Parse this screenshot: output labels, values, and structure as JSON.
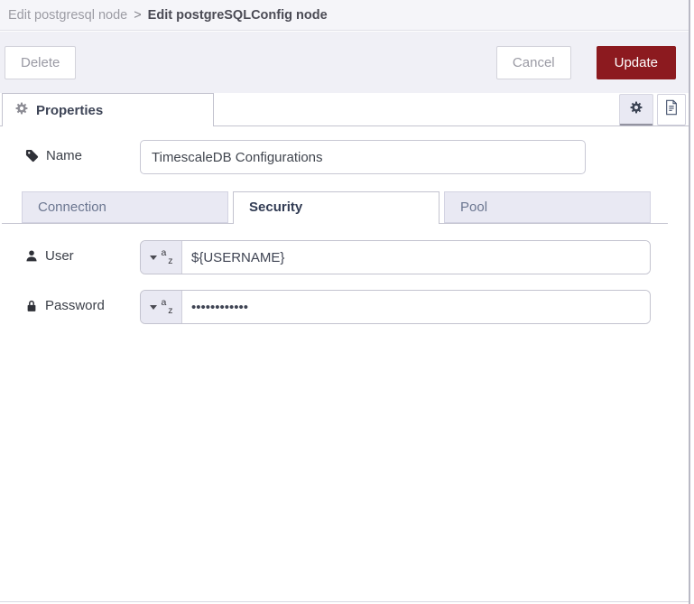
{
  "breadcrumb": {
    "parent": "Edit postgresql node",
    "separator": ">",
    "current": "Edit postgreSQLConfig node"
  },
  "toolbar": {
    "delete": "Delete",
    "cancel": "Cancel",
    "update": "Update"
  },
  "panel_header": {
    "properties_tab": "Properties",
    "icons": [
      "gear-icon",
      "document-icon"
    ]
  },
  "form": {
    "name_field": {
      "label": "Name",
      "value": "TimescaleDB Configurations"
    },
    "tabs": [
      {
        "label": "Connection",
        "active": false
      },
      {
        "label": "Security",
        "active": true
      },
      {
        "label": "Pool",
        "active": false
      }
    ],
    "user_field": {
      "label": "User",
      "type_glyph_top": "a",
      "type_glyph_bottom": "z",
      "value": "${USERNAME}"
    },
    "password_field": {
      "label": "Password",
      "type_glyph_top": "a",
      "type_glyph_bottom": "z",
      "value": "••••••••••••"
    }
  },
  "colors": {
    "update_button": "#8c1a1f",
    "toolbar_bg": "#f0f0f6",
    "header_bg": "#f5f5f9",
    "tab_inactive_bg": "#e9e9f3"
  }
}
